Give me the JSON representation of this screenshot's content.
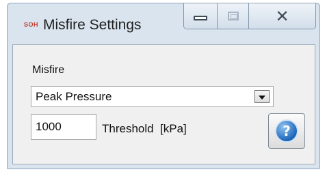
{
  "window": {
    "title": "Misfire Settings",
    "app_icon_text": "SOH"
  },
  "title_buttons": {
    "minimize": "minimize-icon",
    "maximize": "maximize-icon",
    "close": "close-icon",
    "close_glyph": "✕"
  },
  "misfire": {
    "group_label": "Misfire",
    "mode_selected": "Peak Pressure"
  },
  "threshold": {
    "value": "1000",
    "label": "Threshold  [kPa]"
  },
  "help": {
    "icon": "help-icon",
    "glyph": "?"
  },
  "colors": {
    "titlebar": "#dae4ef",
    "client": "#f0f0f0",
    "help_blue": "#1d66b8"
  }
}
